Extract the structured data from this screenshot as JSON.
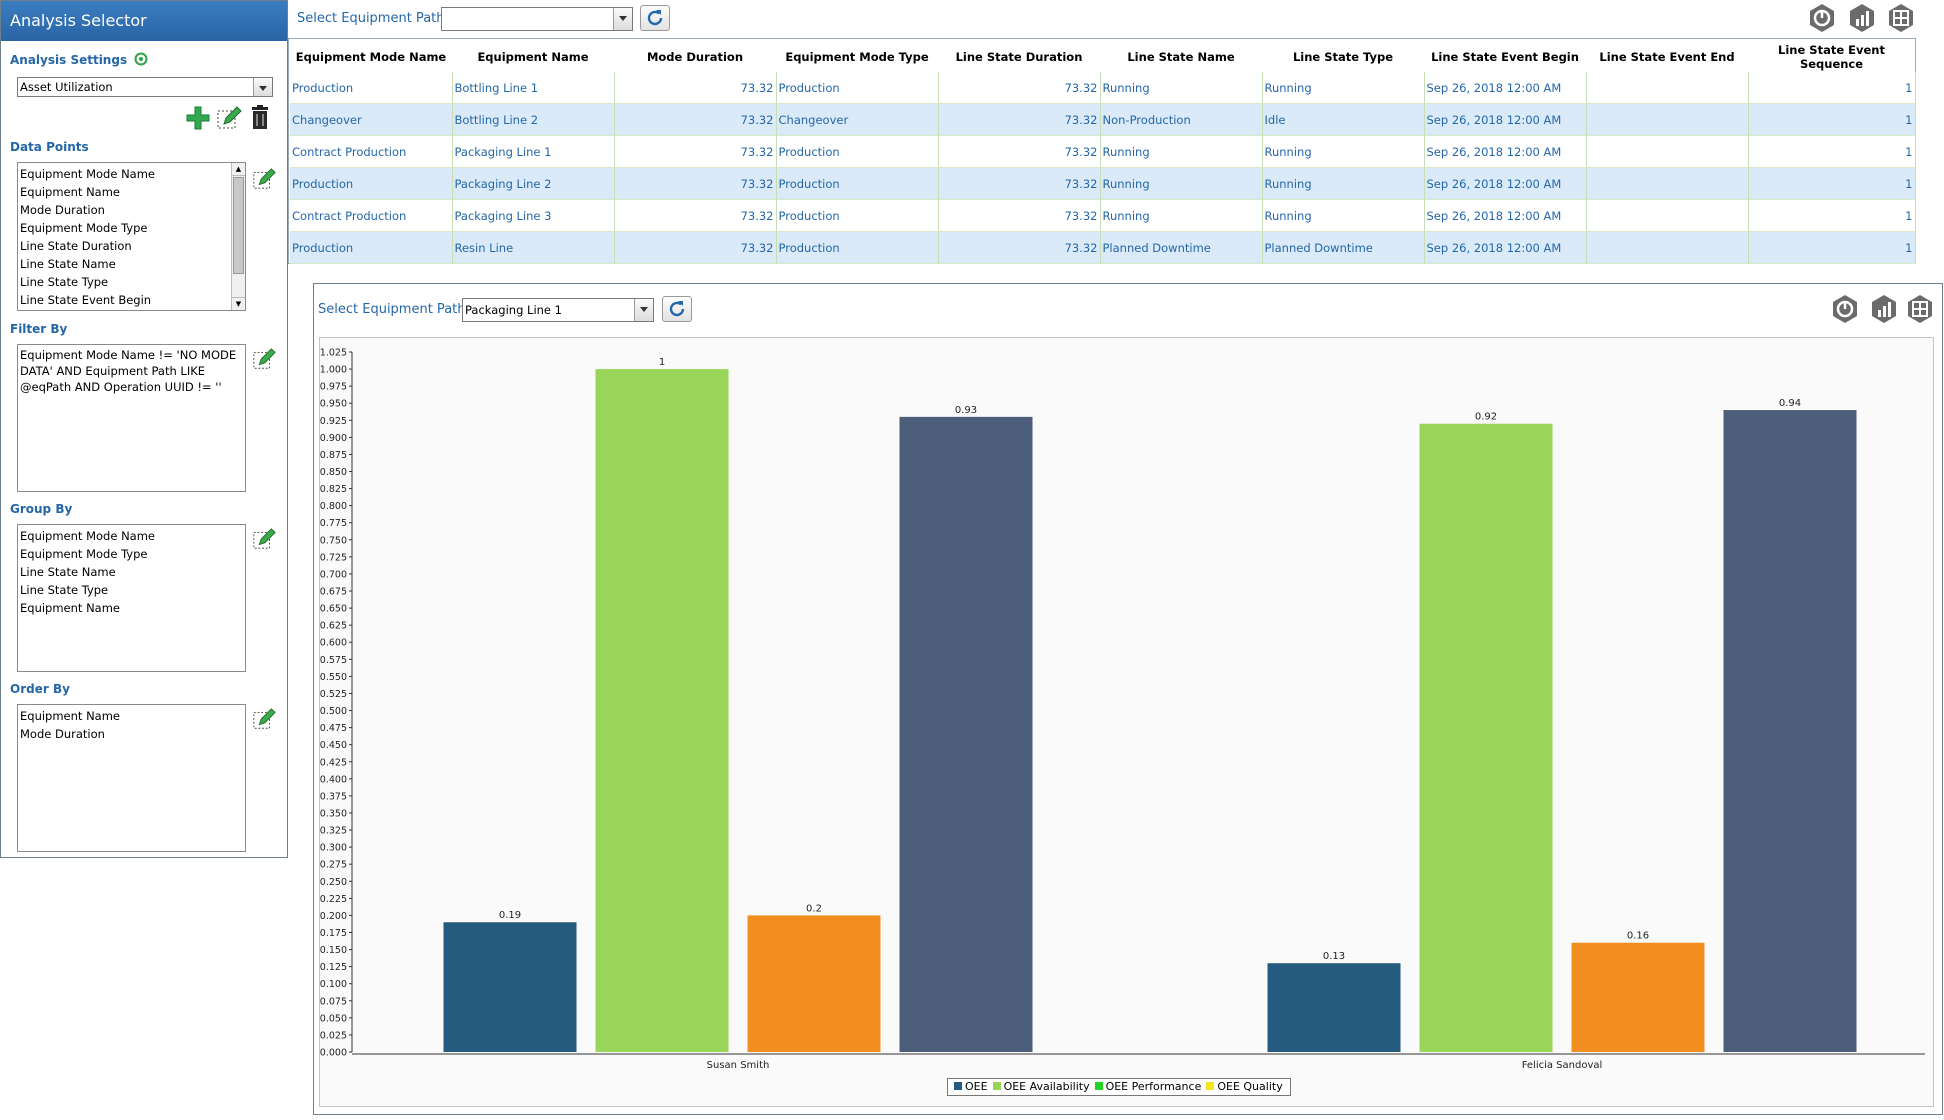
{
  "left_panel": {
    "title": "Analysis Selector",
    "settings_label": "Analysis Settings",
    "settings_value": "Asset Utilization",
    "data_points_label": "Data Points",
    "data_points": [
      "Equipment Mode Name",
      "Equipment Name",
      "Mode Duration",
      "Equipment Mode Type",
      "Line State Duration",
      "Line State Name",
      "Line State Type",
      "Line State Event Begin"
    ],
    "filter_label": "Filter By",
    "filter_lines": [
      "Equipment Mode Name != 'NO MODE",
      "DATA'  AND  Equipment Path LIKE",
      "@eqPath AND  Operation UUID != ''"
    ],
    "group_label": "Group By",
    "group_items": [
      "Equipment Mode Name",
      "Equipment Mode Type",
      "Line State Name",
      "Line State Type",
      "Equipment Name"
    ],
    "order_label": "Order By",
    "order_items": [
      "Equipment Name",
      "Mode Duration"
    ]
  },
  "top": {
    "path_label": "Select Equipment Path",
    "path_value": ""
  },
  "table": {
    "columns": [
      "Equipment Mode Name",
      "Equipment Name",
      "Mode Duration",
      "Equipment Mode Type",
      "Line State Duration",
      "Line State Name",
      "Line State Type",
      "Line State Event Begin",
      "Line State Event End",
      "Line State Event Sequence"
    ],
    "rows": [
      [
        "Production",
        "Bottling Line 1",
        "73.32",
        "Production",
        "73.32",
        "Running",
        "Running",
        "Sep 26, 2018 12:00 AM",
        "",
        "1"
      ],
      [
        "Changeover",
        "Bottling Line 2",
        "73.32",
        "Changeover",
        "73.32",
        "Non-Production",
        "Idle",
        "Sep 26, 2018 12:00 AM",
        "",
        "1"
      ],
      [
        "Contract Production",
        "Packaging Line 1",
        "73.32",
        "Production",
        "73.32",
        "Running",
        "Running",
        "Sep 26, 2018 12:00 AM",
        "",
        "1"
      ],
      [
        "Production",
        "Packaging Line 2",
        "73.32",
        "Production",
        "73.32",
        "Running",
        "Running",
        "Sep 26, 2018 12:00 AM",
        "",
        "1"
      ],
      [
        "Contract Production",
        "Packaging Line 3",
        "73.32",
        "Production",
        "73.32",
        "Running",
        "Running",
        "Sep 26, 2018 12:00 AM",
        "",
        "1"
      ],
      [
        "Production",
        "Resin Line",
        "73.32",
        "Production",
        "73.32",
        "Planned Downtime",
        "Planned Downtime",
        "Sep 26, 2018 12:00 AM",
        "",
        "1"
      ]
    ]
  },
  "chart_window": {
    "path_label": "Select Equipment Path",
    "path_value": "Packaging Line 1"
  },
  "colors": {
    "oee": "#265b80",
    "availability": "#99d559",
    "performance": "#f28e1f",
    "quality_legend": "#f5e61b",
    "dark_bar": "#4c5e7a",
    "accent_blue": "#2467a8"
  },
  "chart_data": {
    "type": "bar",
    "categories": [
      "Susan Smith",
      "Felicia Sandoval"
    ],
    "series": [
      {
        "name": "OEE",
        "values": [
          0.19,
          0.13
        ]
      },
      {
        "name": "OEE Availability",
        "values": [
          1,
          0.92
        ]
      },
      {
        "name": "OEE Performance",
        "values": [
          0.2,
          0.16
        ]
      },
      {
        "name": "OEE Quality",
        "values": [
          0.93,
          0.94
        ]
      }
    ],
    "value_labels": [
      [
        "0.19",
        "0.13"
      ],
      [
        "1",
        "0.92"
      ],
      [
        "0.2",
        "0.16"
      ],
      [
        "0.93",
        "0.94"
      ]
    ],
    "legend_swatches": [
      "#265b80",
      "#99d559",
      "#22d422",
      "#f5e61b"
    ],
    "bar_colors": [
      "#265b80",
      "#99d559",
      "#f28e1f",
      "#4c5e7a"
    ],
    "ylim": [
      0,
      1.025
    ],
    "ytick_step": 0.025,
    "legend_position": "bottom-center",
    "grid": false
  }
}
